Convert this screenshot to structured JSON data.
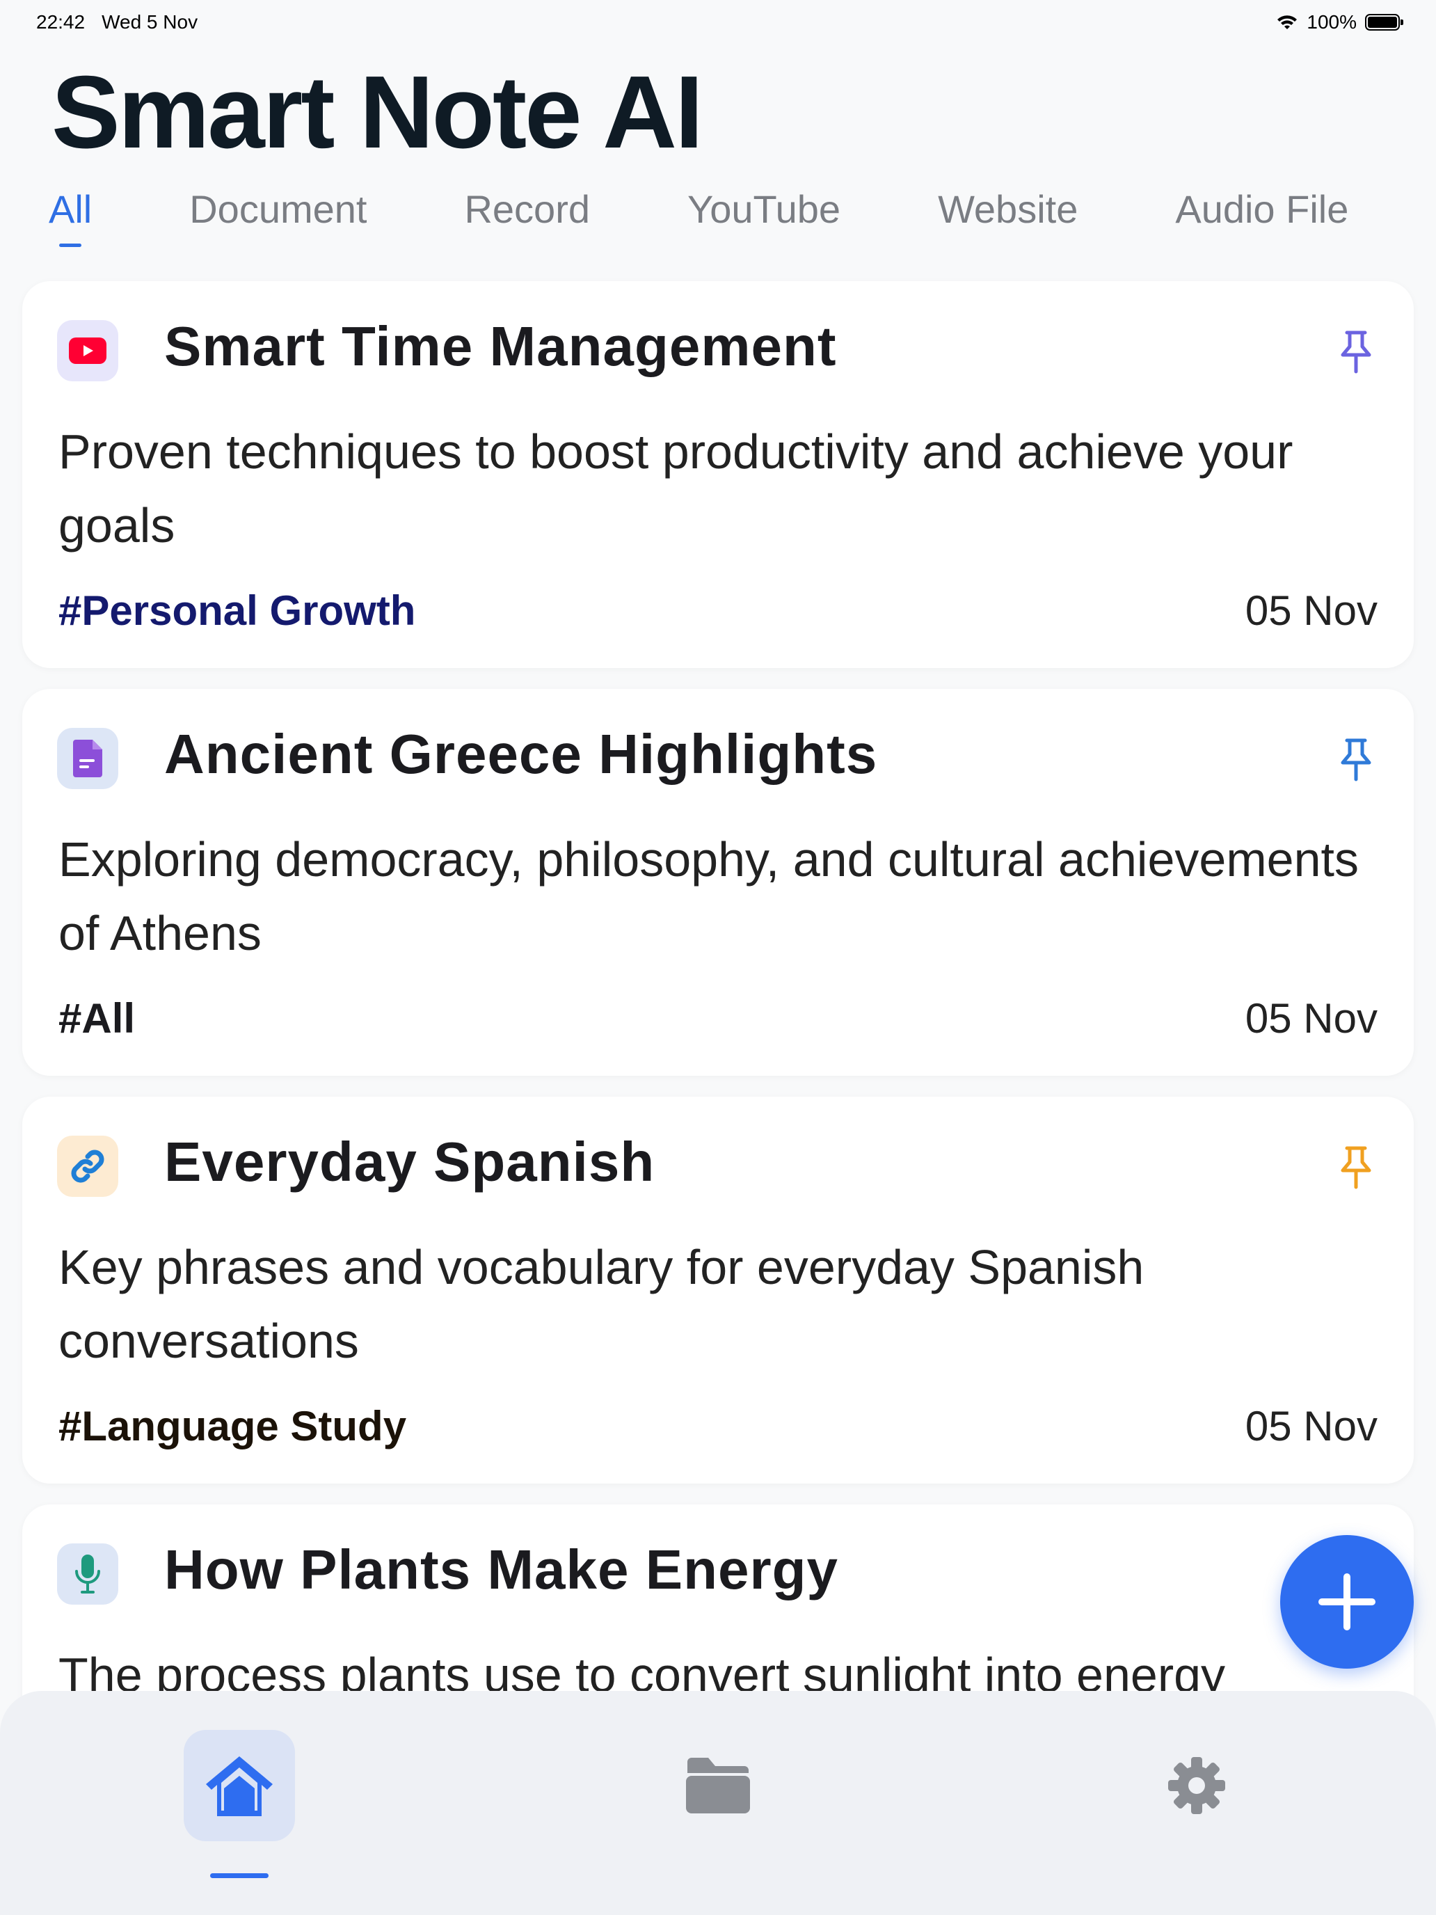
{
  "status_bar": {
    "time": "22:42",
    "date": "Wed 5 Nov",
    "battery": "100%"
  },
  "app": {
    "title": "Smart Note AI"
  },
  "tabs": [
    {
      "label": "All",
      "active": true
    },
    {
      "label": "Document",
      "active": false
    },
    {
      "label": "Record",
      "active": false
    },
    {
      "label": "YouTube",
      "active": false
    },
    {
      "label": "Website",
      "active": false
    },
    {
      "label": "Audio File",
      "active": false
    }
  ],
  "notes": [
    {
      "icon": "youtube-icon",
      "title": "Smart Time Management",
      "description": "Proven techniques to boost productivity and achieve your goals",
      "tag": "#Personal Growth",
      "tag_color": "#141a6e",
      "date": "05 Nov",
      "pin_color": "#6b63e0"
    },
    {
      "icon": "document-icon",
      "title": "Ancient Greece Highlights",
      "description": "Exploring democracy, philosophy, and cultural achievements of Athens",
      "tag": "#All",
      "tag_color": "#1b1b1f",
      "date": "05 Nov",
      "pin_color": "#2f7ad8"
    },
    {
      "icon": "link-icon",
      "title": "Everyday Spanish",
      "description": "Key phrases and vocabulary for everyday Spanish conversations",
      "tag": "#Language Study",
      "tag_color": "#1b1208",
      "date": "05 Nov",
      "pin_color": "#f0a020"
    },
    {
      "icon": "microphone-icon",
      "title": "How Plants Make Energy",
      "description": "The process plants use to convert sunlight into energy",
      "tag": "",
      "date": ""
    }
  ],
  "colors": {
    "accent": "#2e6df0",
    "background": "#f8f9fa"
  },
  "nav": {
    "items": [
      "home-icon",
      "folder-icon",
      "settings-icon"
    ],
    "active": "home"
  }
}
